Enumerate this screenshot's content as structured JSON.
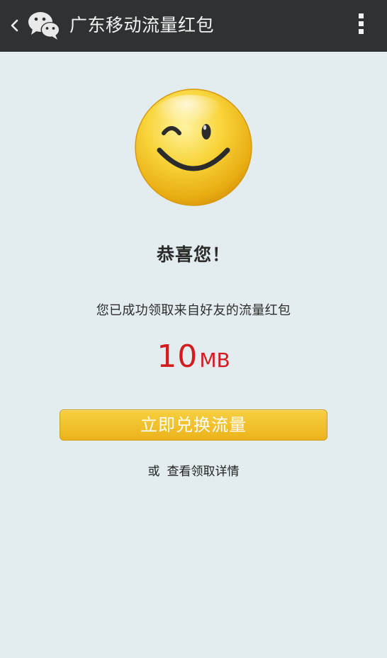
{
  "header": {
    "title": "广东移动流量红包",
    "back_icon": "chevron-left-icon",
    "app_icon": "wechat-icon",
    "menu_icon": "more-vertical-icon",
    "background": "#2f3133"
  },
  "main": {
    "emoji_icon": "wink-smiley-icon",
    "congrats": "恭喜您！",
    "description": "您已成功领取来自好友的流量红包",
    "amount": {
      "value": "10",
      "unit": "MB",
      "color": "#d21c1f"
    },
    "redeem_button": "立即兑换流量",
    "or_label": "或",
    "details_link": "查看领取详情",
    "accent": "#ecb31a"
  }
}
